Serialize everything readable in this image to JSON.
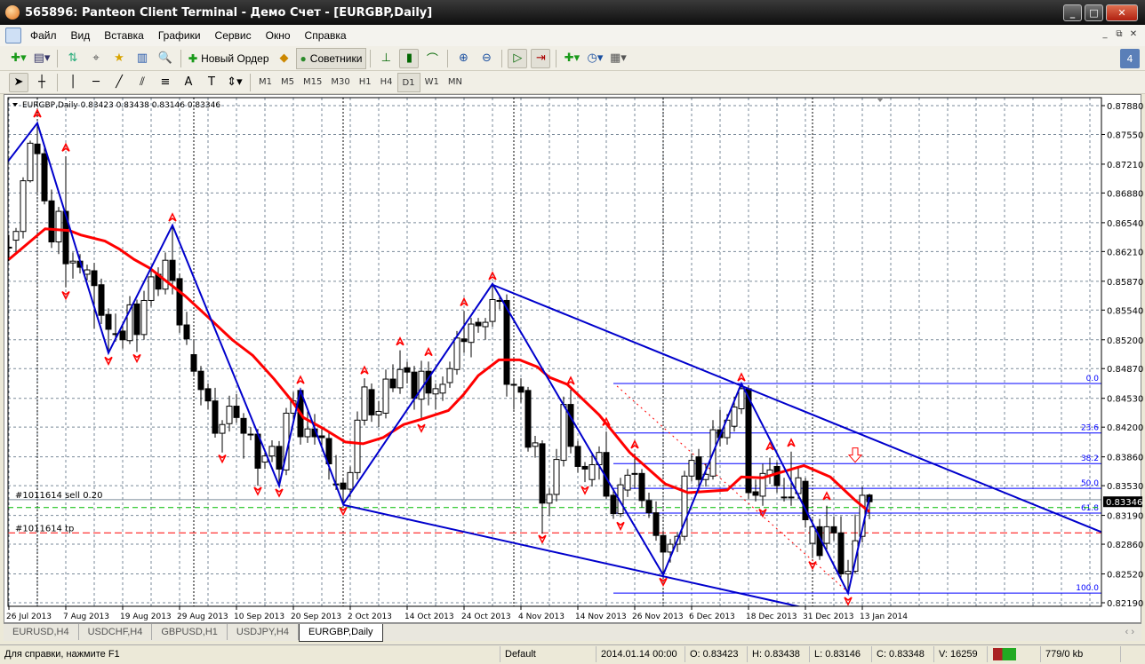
{
  "window": {
    "title": "565896: Panteon Client Terminal - Демо Счет - [EURGBP,Daily]"
  },
  "menu": [
    "Файл",
    "Вид",
    "Вставка",
    "Графики",
    "Сервис",
    "Окно",
    "Справка"
  ],
  "toolbar": {
    "new_order": "Новый Ордер",
    "experts": "Советники",
    "badge": "4"
  },
  "timeframes": [
    "M1",
    "M5",
    "M15",
    "M30",
    "H1",
    "H4",
    "D1",
    "W1",
    "MN"
  ],
  "active_timeframe": "D1",
  "tabs": [
    "EURUSD,H4",
    "USDCHF,H4",
    "GBPUSD,H1",
    "USDJPY,H4",
    "EURGBP,Daily"
  ],
  "active_tab": "EURGBP,Daily",
  "status": {
    "help": "Для справки, нажмите F1",
    "profile": "Default",
    "time": "2014.01.14 00:00",
    "open": "O: 0.83423",
    "high": "H: 0.83438",
    "low": "L: 0.83146",
    "close": "C: 0.83348",
    "volume": "V: 16259",
    "traffic": "779/0 kb"
  },
  "colors": {
    "bull": "#ffffff",
    "bear": "#000000",
    "ma": "#ff0000",
    "zigzag": "#0000cc",
    "fibo": "#0000ff",
    "fractal": "#ff0000"
  },
  "chart_data": {
    "type": "candlestick",
    "header": "EURGBP,Daily  0.83423 0.83438 0.83146 0.83346",
    "current_price": "0.83346",
    "ylim": [
      0.8219,
      0.8788
    ],
    "price_ticks": [
      "0.87880",
      "0.87550",
      "0.87210",
      "0.86880",
      "0.86540",
      "0.86210",
      "0.85870",
      "0.85540",
      "0.85200",
      "0.84870",
      "0.84530",
      "0.84200",
      "0.83860",
      "0.83530",
      "0.83190",
      "0.82860",
      "0.82520",
      "0.82190"
    ],
    "date_labels": [
      [
        0,
        "26 Jul 2013"
      ],
      [
        8,
        "7 Aug 2013"
      ],
      [
        16,
        "19 Aug 2013"
      ],
      [
        24,
        "29 Aug 2013"
      ],
      [
        32,
        "10 Sep 2013"
      ],
      [
        40,
        "20 Sep 2013"
      ],
      [
        48,
        "2 Oct 2013"
      ],
      [
        56,
        "14 Oct 2013"
      ],
      [
        64,
        "24 Oct 2013"
      ],
      [
        72,
        "4 Nov 2013"
      ],
      [
        80,
        "14 Nov 2013"
      ],
      [
        88,
        "26 Nov 2013"
      ],
      [
        96,
        "6 Dec 2013"
      ],
      [
        104,
        "18 Dec 2013"
      ],
      [
        112,
        "31 Dec 2013"
      ],
      [
        120,
        "13 Jan 2014"
      ]
    ],
    "period_separators": [
      4,
      26,
      47,
      71,
      92,
      113
    ],
    "ohlc": [
      [
        0.8626,
        0.864,
        0.861,
        0.8626
      ],
      [
        0.8634,
        0.8648,
        0.862,
        0.8644
      ],
      [
        0.8644,
        0.8706,
        0.8636,
        0.8702
      ],
      [
        0.8702,
        0.8748,
        0.87,
        0.8745
      ],
      [
        0.8744,
        0.8768,
        0.8688,
        0.8733
      ],
      [
        0.8733,
        0.874,
        0.8675,
        0.8679
      ],
      [
        0.8679,
        0.8692,
        0.8625,
        0.8632
      ],
      [
        0.8632,
        0.8672,
        0.8618,
        0.8667
      ],
      [
        0.8667,
        0.873,
        0.858,
        0.8607
      ],
      [
        0.8608,
        0.862,
        0.859,
        0.861
      ],
      [
        0.861,
        0.8618,
        0.8596,
        0.8603
      ],
      [
        0.8595,
        0.8606,
        0.8588,
        0.86
      ],
      [
        0.8599,
        0.8608,
        0.8533,
        0.8582
      ],
      [
        0.8583,
        0.859,
        0.8538,
        0.8548
      ],
      [
        0.8549,
        0.8556,
        0.8505,
        0.8532
      ],
      [
        0.8527,
        0.855,
        0.8518,
        0.8527
      ],
      [
        0.853,
        0.8536,
        0.851,
        0.852
      ],
      [
        0.8519,
        0.857,
        0.8515,
        0.856
      ],
      [
        0.8561,
        0.8566,
        0.8506,
        0.8526
      ],
      [
        0.8526,
        0.8576,
        0.852,
        0.8565
      ],
      [
        0.8565,
        0.86,
        0.8558,
        0.8592
      ],
      [
        0.8595,
        0.8603,
        0.857,
        0.8578
      ],
      [
        0.8578,
        0.862,
        0.8572,
        0.8611
      ],
      [
        0.8611,
        0.8652,
        0.8572,
        0.8588
      ],
      [
        0.859,
        0.8596,
        0.8528,
        0.8537
      ],
      [
        0.8537,
        0.8552,
        0.8514,
        0.8521
      ],
      [
        0.8503,
        0.852,
        0.8478,
        0.8484
      ],
      [
        0.8484,
        0.849,
        0.8445,
        0.8463
      ],
      [
        0.8464,
        0.847,
        0.844,
        0.845
      ],
      [
        0.845,
        0.8465,
        0.8408,
        0.8413
      ],
      [
        0.8413,
        0.8428,
        0.8391,
        0.8423
      ],
      [
        0.8424,
        0.8456,
        0.8415,
        0.8444
      ],
      [
        0.8444,
        0.8458,
        0.8425,
        0.8431
      ],
      [
        0.843,
        0.8436,
        0.8384,
        0.8413
      ],
      [
        0.8412,
        0.842,
        0.8405,
        0.8412
      ],
      [
        0.8412,
        0.8418,
        0.8353,
        0.8373
      ],
      [
        0.838,
        0.8395,
        0.8372,
        0.8387
      ],
      [
        0.8387,
        0.8405,
        0.838,
        0.8398
      ],
      [
        0.8398,
        0.8404,
        0.8353,
        0.8372
      ],
      [
        0.8371,
        0.8442,
        0.8365,
        0.8436
      ],
      [
        0.8436,
        0.846,
        0.8428,
        0.845
      ],
      [
        0.8462,
        0.8465,
        0.84,
        0.8409
      ],
      [
        0.8409,
        0.8438,
        0.8402,
        0.8418
      ],
      [
        0.8418,
        0.8435,
        0.84,
        0.8409
      ],
      [
        0.841,
        0.842,
        0.8398,
        0.8408
      ],
      [
        0.8407,
        0.8414,
        0.836,
        0.8378
      ],
      [
        0.8355,
        0.8388,
        0.8348,
        0.8355
      ],
      [
        0.8356,
        0.8362,
        0.8332,
        0.8349
      ],
      [
        0.8349,
        0.8375,
        0.834,
        0.8368
      ],
      [
        0.8368,
        0.8438,
        0.836,
        0.8428
      ],
      [
        0.8428,
        0.8476,
        0.8422,
        0.8466
      ],
      [
        0.8463,
        0.847,
        0.8426,
        0.8434
      ],
      [
        0.8434,
        0.845,
        0.842,
        0.8438
      ],
      [
        0.8436,
        0.8486,
        0.843,
        0.8475
      ],
      [
        0.8475,
        0.8492,
        0.846,
        0.8465
      ],
      [
        0.8465,
        0.8508,
        0.8458,
        0.8486
      ],
      [
        0.8488,
        0.8495,
        0.847,
        0.8483
      ],
      [
        0.8483,
        0.849,
        0.844,
        0.8453
      ],
      [
        0.8452,
        0.8496,
        0.8428,
        0.8484
      ],
      [
        0.8484,
        0.8495,
        0.8445,
        0.8459
      ],
      [
        0.8458,
        0.847,
        0.844,
        0.8464
      ],
      [
        0.8459,
        0.8478,
        0.845,
        0.8469
      ],
      [
        0.8471,
        0.8495,
        0.8465,
        0.8487
      ],
      [
        0.8486,
        0.853,
        0.848,
        0.8522
      ],
      [
        0.8521,
        0.8553,
        0.8505,
        0.8518
      ],
      [
        0.8517,
        0.8545,
        0.85,
        0.8538
      ],
      [
        0.854,
        0.8545,
        0.8528,
        0.8536
      ],
      [
        0.8535,
        0.8545,
        0.852,
        0.854
      ],
      [
        0.8541,
        0.8584,
        0.8535,
        0.8566
      ],
      [
        0.8565,
        0.857,
        0.8555,
        0.8565
      ],
      [
        0.8565,
        0.8572,
        0.8455,
        0.8469
      ],
      [
        0.8469,
        0.8475,
        0.844,
        0.8469
      ],
      [
        0.8466,
        0.8476,
        0.8448,
        0.846
      ],
      [
        0.8462,
        0.8466,
        0.8392,
        0.8397
      ],
      [
        0.8398,
        0.841,
        0.8385,
        0.8402
      ],
      [
        0.8401,
        0.8405,
        0.8298,
        0.8333
      ],
      [
        0.8333,
        0.835,
        0.8318,
        0.8343
      ],
      [
        0.8343,
        0.8395,
        0.8335,
        0.8383
      ],
      [
        0.8382,
        0.8455,
        0.8375,
        0.8446
      ],
      [
        0.8446,
        0.8463,
        0.839,
        0.8398
      ],
      [
        0.8398,
        0.8404,
        0.8368,
        0.8375
      ],
      [
        0.8375,
        0.838,
        0.8357,
        0.8372
      ],
      [
        0.836,
        0.839,
        0.8352,
        0.8377
      ],
      [
        0.8377,
        0.8398,
        0.836,
        0.8391
      ],
      [
        0.8391,
        0.8415,
        0.8338,
        0.8341
      ],
      [
        0.8342,
        0.835,
        0.8315,
        0.8321
      ],
      [
        0.8321,
        0.8362,
        0.8317,
        0.8354
      ],
      [
        0.8348,
        0.8372,
        0.834,
        0.8365
      ],
      [
        0.8367,
        0.839,
        0.835,
        0.8367
      ],
      [
        0.8367,
        0.8372,
        0.8328,
        0.8336
      ],
      [
        0.8336,
        0.8345,
        0.8316,
        0.8322
      ],
      [
        0.8322,
        0.8335,
        0.829,
        0.8296
      ],
      [
        0.8296,
        0.83,
        0.8251,
        0.8277
      ],
      [
        0.8277,
        0.8292,
        0.8265,
        0.8286
      ],
      [
        0.8286,
        0.83,
        0.8277,
        0.8295
      ],
      [
        0.8295,
        0.837,
        0.829,
        0.8364
      ],
      [
        0.8364,
        0.839,
        0.8358,
        0.8382
      ],
      [
        0.8386,
        0.8395,
        0.8345,
        0.836
      ],
      [
        0.836,
        0.8378,
        0.8352,
        0.8366
      ],
      [
        0.8364,
        0.8428,
        0.836,
        0.8417
      ],
      [
        0.8417,
        0.844,
        0.8398,
        0.8408
      ],
      [
        0.8408,
        0.8435,
        0.84,
        0.8428
      ],
      [
        0.8421,
        0.8455,
        0.8415,
        0.8443
      ],
      [
        0.8441,
        0.847,
        0.8435,
        0.8464
      ],
      [
        0.8464,
        0.8468,
        0.8338,
        0.8345
      ],
      [
        0.8346,
        0.836,
        0.8335,
        0.8342
      ],
      [
        0.8341,
        0.8378,
        0.833,
        0.8367
      ],
      [
        0.8365,
        0.8385,
        0.8355,
        0.8371
      ],
      [
        0.8375,
        0.838,
        0.8345,
        0.8353
      ],
      [
        0.834,
        0.8362,
        0.8335,
        0.834
      ],
      [
        0.834,
        0.8392,
        0.833,
        0.834
      ],
      [
        0.8344,
        0.8375,
        0.8338,
        0.8362
      ],
      [
        0.8358,
        0.8362,
        0.8305,
        0.8314
      ],
      [
        0.8287,
        0.8315,
        0.827,
        0.8306
      ],
      [
        0.8306,
        0.8315,
        0.8268,
        0.8273
      ],
      [
        0.8287,
        0.833,
        0.828,
        0.8306
      ],
      [
        0.8306,
        0.8318,
        0.829,
        0.8299
      ],
      [
        0.8299,
        0.8318,
        0.8248,
        0.8252
      ],
      [
        0.8252,
        0.8268,
        0.823,
        0.8255
      ],
      [
        0.8255,
        0.832,
        0.8252,
        0.829
      ],
      [
        0.8295,
        0.8352,
        0.8288,
        0.8342
      ],
      [
        0.83423,
        0.83438,
        0.83146,
        0.83346
      ]
    ],
    "moving_average": [
      [
        0,
        0.8612
      ],
      [
        5.1,
        0.8647
      ],
      [
        8.5,
        0.8645
      ],
      [
        10.1,
        0.864
      ],
      [
        13.5,
        0.8633
      ],
      [
        15.5,
        0.8624
      ],
      [
        17.6,
        0.8612
      ],
      [
        19.8,
        0.8602
      ],
      [
        22.3,
        0.8586
      ],
      [
        24.8,
        0.857
      ],
      [
        28,
        0.8546
      ],
      [
        31.4,
        0.852
      ],
      [
        34.3,
        0.8502
      ],
      [
        37.3,
        0.8475
      ],
      [
        39.8,
        0.845
      ],
      [
        41.4,
        0.8431
      ],
      [
        44.3,
        0.8418
      ],
      [
        47.3,
        0.8403
      ],
      [
        49.8,
        0.8401
      ],
      [
        52.6,
        0.8408
      ],
      [
        55.5,
        0.8423
      ],
      [
        58,
        0.8429
      ],
      [
        61.8,
        0.8439
      ],
      [
        63.9,
        0.8457
      ],
      [
        66,
        0.8479
      ],
      [
        68.9,
        0.8497
      ],
      [
        71.8,
        0.8497
      ],
      [
        74.3,
        0.8489
      ],
      [
        76,
        0.8477
      ],
      [
        78.5,
        0.8469
      ],
      [
        83,
        0.8434
      ],
      [
        87.3,
        0.8391
      ],
      [
        92.3,
        0.8355
      ],
      [
        95.5,
        0.8345
      ],
      [
        101,
        0.8348
      ],
      [
        103,
        0.8363
      ],
      [
        106,
        0.8362
      ],
      [
        108,
        0.8367
      ],
      [
        111.8,
        0.8376
      ],
      [
        115.5,
        0.8363
      ],
      [
        118.9,
        0.8337
      ],
      [
        121,
        0.8323
      ]
    ],
    "zigzag": [
      [
        -1,
        0.8715
      ],
      [
        4,
        0.8768
      ],
      [
        14,
        0.8505
      ],
      [
        23,
        0.8651
      ],
      [
        38,
        0.8353
      ],
      [
        41,
        0.8462
      ],
      [
        47,
        0.8332
      ],
      [
        68,
        0.8584
      ],
      [
        92,
        0.8251
      ],
      [
        103,
        0.847
      ],
      [
        118,
        0.823
      ],
      [
        121,
        0.834
      ]
    ],
    "channel_lines": [
      [
        [
          68,
          0.8583
        ],
        [
          153.6,
          0.83
        ]
      ],
      [
        [
          47,
          0.8331
        ],
        [
          112,
          0.8213
        ]
      ]
    ],
    "fibo_trendline": [
      [
        85.5,
        0.8467
      ],
      [
        118,
        0.8231
      ]
    ],
    "fibo": {
      "start_index": 85,
      "price_0": 0.847,
      "price_100": 0.823,
      "levels": [
        [
          "0.0",
          0
        ],
        [
          "23.6",
          0.236
        ],
        [
          "38.2",
          0.382
        ],
        [
          "50.0",
          0.5
        ],
        [
          "61.8",
          0.618
        ],
        [
          "100.0",
          1
        ]
      ]
    },
    "fractals": [
      [
        4,
        "up",
        0.8779
      ],
      [
        8,
        "up",
        0.874
      ],
      [
        23,
        "up",
        0.866
      ],
      [
        41,
        "up",
        0.8474
      ],
      [
        50,
        "up",
        0.8485
      ],
      [
        55,
        "up",
        0.8518
      ],
      [
        59,
        "up",
        0.8506
      ],
      [
        64,
        "up",
        0.8563
      ],
      [
        68,
        "up",
        0.8593
      ],
      [
        79,
        "up",
        0.8473
      ],
      [
        84,
        "up",
        0.8426
      ],
      [
        88,
        "up",
        0.84
      ],
      [
        103,
        "up",
        0.8477
      ],
      [
        107,
        "up",
        0.8398
      ],
      [
        110,
        "up",
        0.8402
      ],
      [
        115,
        "up",
        0.8341
      ],
      [
        8,
        "down",
        0.8571
      ],
      [
        14,
        "down",
        0.8496
      ],
      [
        18,
        "down",
        0.8499
      ],
      [
        30,
        "down",
        0.8384
      ],
      [
        35,
        "down",
        0.8347
      ],
      [
        38,
        "down",
        0.8345
      ],
      [
        47,
        "down",
        0.8324
      ],
      [
        58,
        "down",
        0.8419
      ],
      [
        75,
        "down",
        0.8292
      ],
      [
        81,
        "down",
        0.8348
      ],
      [
        86,
        "down",
        0.8307
      ],
      [
        92,
        "down",
        0.8243
      ],
      [
        106,
        "down",
        0.8322
      ],
      [
        113,
        "down",
        0.8262
      ],
      [
        118,
        "down",
        0.8221
      ]
    ],
    "signal_arrow": {
      "index": 119,
      "price": 0.8388,
      "direction": "down"
    },
    "orders": [
      {
        "label": "#1011614 sell 0.20",
        "price": 0.8337,
        "color": "#7a8a99"
      },
      {
        "label": "#1011614 tp",
        "price": 0.8299,
        "color": "#ff0000"
      }
    ],
    "stop_line": {
      "price": 0.8328,
      "color": "#00bb00"
    }
  }
}
